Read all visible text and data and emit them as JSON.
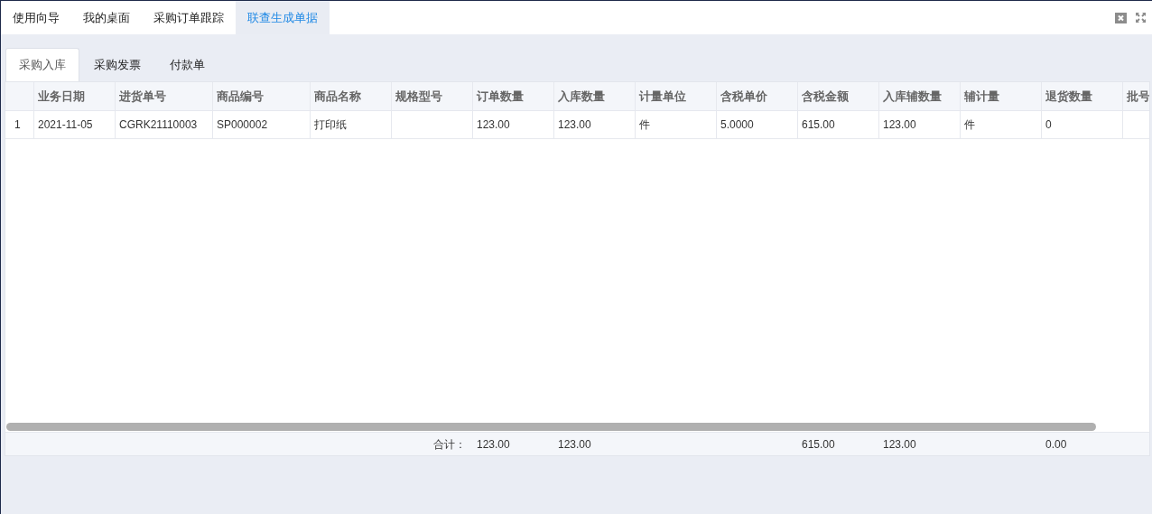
{
  "tabs": [
    {
      "label": "使用向导",
      "selected": false
    },
    {
      "label": "我的桌面",
      "selected": false
    },
    {
      "label": "采购订单跟踪",
      "selected": false
    },
    {
      "label": "联查生成单据",
      "selected": true
    }
  ],
  "sub_tabs": [
    {
      "label": "采购入库",
      "selected": true
    },
    {
      "label": "采购发票",
      "selected": false
    },
    {
      "label": "付款单",
      "selected": false
    }
  ],
  "table": {
    "columns": [
      {
        "label": "业务日期"
      },
      {
        "label": "进货单号"
      },
      {
        "label": "商品编号"
      },
      {
        "label": "商品名称"
      },
      {
        "label": "规格型号"
      },
      {
        "label": "订单数量",
        "total": "123.00"
      },
      {
        "label": "入库数量",
        "total": "123.00"
      },
      {
        "label": "计量单位"
      },
      {
        "label": "含税单价"
      },
      {
        "label": "含税金额",
        "total": "615.00"
      },
      {
        "label": "入库辅数量",
        "total": "123.00"
      },
      {
        "label": "辅计量"
      },
      {
        "label": "退货数量",
        "total": "0.00"
      },
      {
        "label": "批号"
      }
    ],
    "rows": [
      {
        "number": "1",
        "cells": [
          "2021-11-05",
          "CGRK21110003",
          "SP000002",
          "打印纸",
          null,
          "123.00",
          "123.00",
          "件",
          "5.0000",
          "615.00",
          "123.00",
          "件",
          "0",
          null
        ]
      }
    ],
    "footer": {
      "label": "合计："
    }
  }
}
